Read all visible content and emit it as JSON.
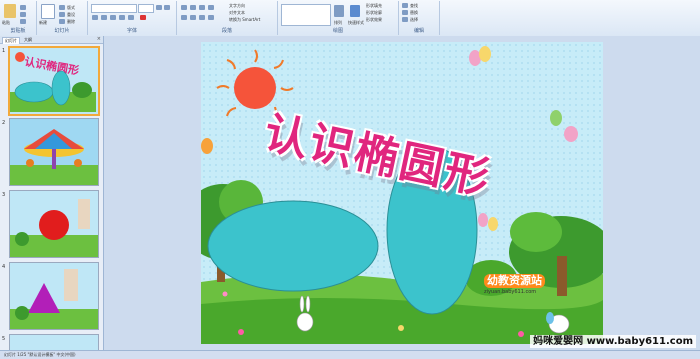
{
  "ribbon": {
    "groups": [
      {
        "id": "clipboard",
        "label": "剪贴板"
      },
      {
        "id": "slides",
        "label": "幻灯片"
      },
      {
        "id": "font",
        "label": "字体"
      },
      {
        "id": "paragraph",
        "label": "段落"
      },
      {
        "id": "drawing",
        "label": "绘图"
      },
      {
        "id": "editing",
        "label": "编辑"
      }
    ],
    "items": [
      "粘贴",
      "新建",
      "版式",
      "重设",
      "删除",
      "文字方向",
      "对齐文本",
      "转换为 SmartArt",
      "排列",
      "快速样式",
      "形状填充",
      "形状轮廓",
      "形状效果",
      "查找",
      "替换",
      "选择"
    ]
  },
  "pane": {
    "tabs": [
      "幻灯片",
      "大纲"
    ],
    "close": "×",
    "slide_numbers": [
      "1",
      "2",
      "3",
      "4",
      "5"
    ]
  },
  "slide": {
    "title": "认识椭圆形",
    "logo_text": "幼教资源站",
    "logo_url": "ziyuan.baby611.com"
  },
  "status": {
    "left": "幻灯片 1/25  \"默认设计模板\"  中文(中国)"
  },
  "watermark": {
    "text": "妈咪爱婴网 www.baby611.com"
  },
  "colors": {
    "title": "#e0267e",
    "ellipse": "#3cc3cc",
    "sky": "#bfe7f6",
    "grass": "#66bb3a"
  }
}
